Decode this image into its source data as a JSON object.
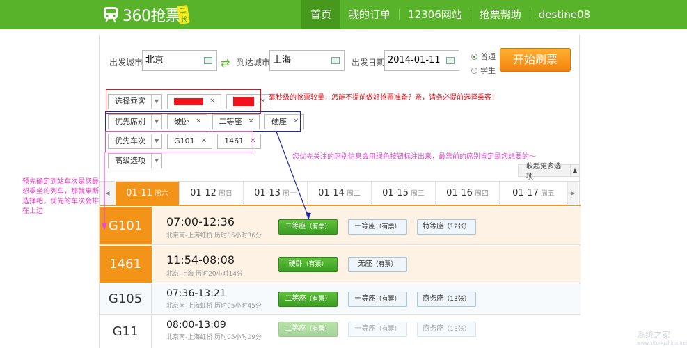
{
  "brand": {
    "name": "360抢票",
    "badge": "二代"
  },
  "nav": [
    "首页",
    "我的订单",
    "12306网站",
    "抢票帮助",
    "destine08"
  ],
  "search": {
    "from_label": "出发城市",
    "from_value": "北京",
    "to_label": "到达城市",
    "to_value": "上海",
    "date_label": "出发日期",
    "date_value": "2014-01-11",
    "ticket_types": [
      "普通",
      "学生"
    ],
    "start_button": "开始刷票"
  },
  "filters": {
    "passenger_label": "选择乘客",
    "seat_label": "优先席别",
    "seat_tags": [
      "硬卧",
      "二等座",
      "硬座"
    ],
    "train_label": "优先车次",
    "train_tags": [
      "G101",
      "1461"
    ],
    "advanced_label": "高级选项",
    "collapse_label": "收起更多选项"
  },
  "notes": {
    "passenger_hint": "毫秒级的抢票较量，怎能不提前做好抢票准备？亲，请务必提前选择乘客！",
    "seat_hint": "您优先关注的席别信息会用绿色按钮标注出来，最靠前的席别肯定是您想要的～",
    "train_hint": "预先确定到站车次是您最想乘坐的列车，那就果断选择吧，优先的车次会排在上边"
  },
  "date_tabs": [
    {
      "date": "01-11",
      "weekday": "周六"
    },
    {
      "date": "01-12",
      "weekday": "周日"
    },
    {
      "date": "01-13",
      "weekday": "周一"
    },
    {
      "date": "01-14",
      "weekday": "周二"
    },
    {
      "date": "01-15",
      "weekday": "周三"
    },
    {
      "date": "01-16",
      "weekday": "周四"
    },
    {
      "date": "01-17",
      "weekday": "周五"
    }
  ],
  "trains": [
    {
      "code": "G101",
      "time": "07:00-12:36",
      "route": "北京南-上海虹桥 历时05小时36分",
      "seats": [
        {
          "name": "二等座",
          "status": "有票"
        },
        {
          "name": "一等座",
          "status": "有票"
        },
        {
          "name": "特等座",
          "status": "12张"
        }
      ]
    },
    {
      "code": "1461",
      "time": "11:54-08:08",
      "route": "北京-上海 历时20小时14分",
      "seats": [
        {
          "name": "硬卧",
          "status": "有票"
        },
        {
          "name": "无座",
          "status": "有票"
        }
      ]
    },
    {
      "code": "G105",
      "time": "07:36-13:21",
      "route": "北京南-上海虹桥 历时05小时45分",
      "seats": [
        {
          "name": "二等座",
          "status": "有票"
        },
        {
          "name": "一等座",
          "status": "有票"
        },
        {
          "name": "商务座",
          "status": "13张"
        }
      ]
    },
    {
      "code": "G11",
      "time": "08:00-13:09",
      "route": "北京南-上海虹桥 历时05小时09分",
      "seats": [
        {
          "name": "二等座",
          "status": "有票"
        },
        {
          "name": "一等座",
          "status": "有票"
        },
        {
          "name": "商务座",
          "status": "13张"
        }
      ]
    }
  ],
  "watermark": {
    "main": "系统之家",
    "sub": "www.xitongzhijia.net"
  }
}
